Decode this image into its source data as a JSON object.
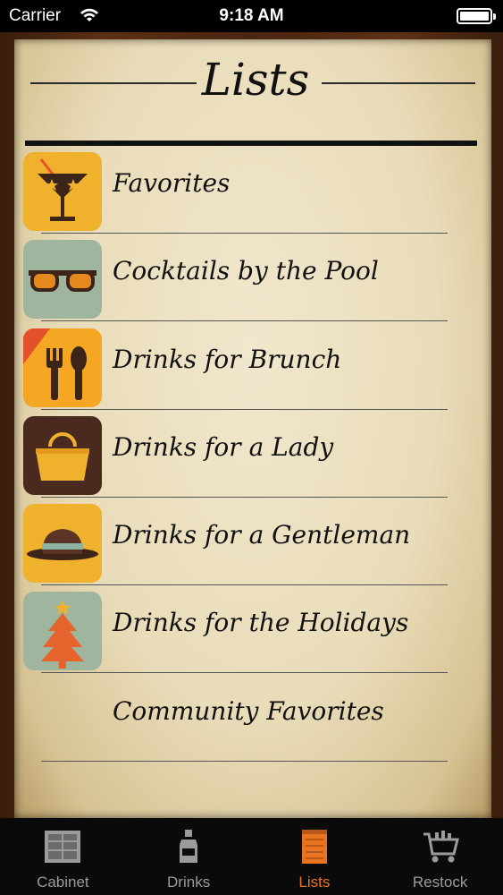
{
  "status_bar": {
    "carrier": "Carrier",
    "time": "9:18 AM"
  },
  "page": {
    "title": "Lists"
  },
  "lists": [
    {
      "label": "Favorites",
      "icon": "cocktail-glass-icon",
      "color": "#f0b12c"
    },
    {
      "label": "Cocktails by the Pool",
      "icon": "sunglasses-icon",
      "color": "#9fb59e"
    },
    {
      "label": "Drinks for Brunch",
      "icon": "fork-knife-icon",
      "color": "#f5a623"
    },
    {
      "label": "Drinks for a Lady",
      "icon": "handbag-icon",
      "color": "#4a2a1e"
    },
    {
      "label": "Drinks for a Gentleman",
      "icon": "fedora-hat-icon",
      "color": "#f0b12c"
    },
    {
      "label": "Drinks for the Holidays",
      "icon": "christmas-tree-icon",
      "color": "#9fb59e"
    },
    {
      "label": "Community Favorites",
      "icon": "",
      "color": ""
    }
  ],
  "tab_bar": {
    "tabs": [
      {
        "label": "Cabinet",
        "icon": "cabinet-icon",
        "active": false
      },
      {
        "label": "Drinks",
        "icon": "bottle-icon",
        "active": false
      },
      {
        "label": "Lists",
        "icon": "list-notepad-icon",
        "active": true
      },
      {
        "label": "Restock",
        "icon": "cart-icon",
        "active": false
      }
    ],
    "active_color": "#e9731f",
    "inactive_color": "#9b9b9b"
  }
}
